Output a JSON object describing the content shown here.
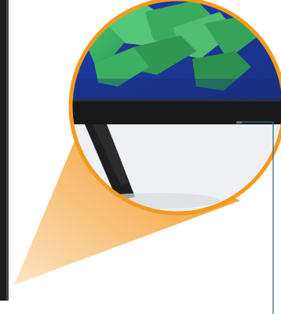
{
  "figure": {
    "accent_color": "#F39A1E",
    "screen_color": "#1F3FA6",
    "bezel_color": "#181818",
    "pointer_color": "#2F6D8C",
    "icons": [
      "tv-bezel-icon",
      "tv-stand-icon",
      "status-led-icon",
      "pointer-line-icon",
      "zoom-beam-icon"
    ]
  }
}
